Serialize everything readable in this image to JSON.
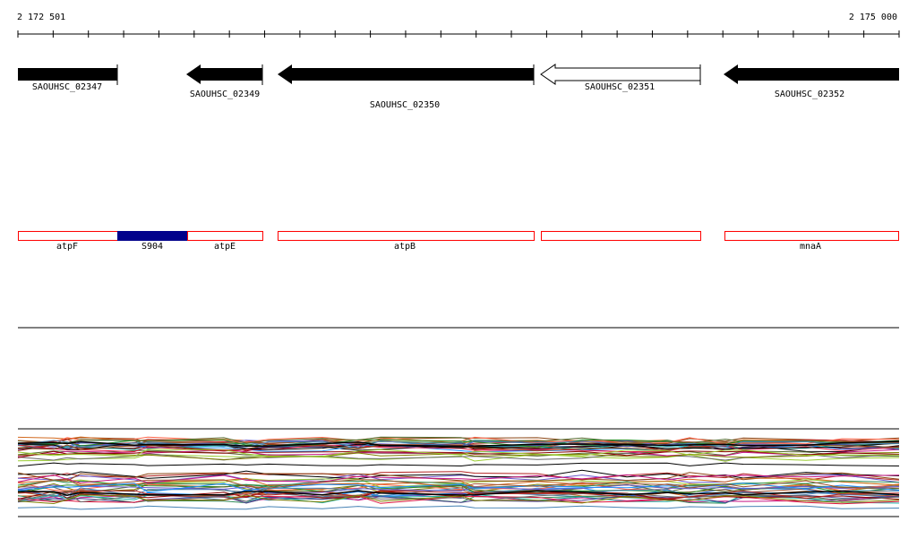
{
  "coordinates": {
    "start": "2 172 501",
    "end": "2 175 000"
  },
  "genes": [
    {
      "name": "SAOUHSC_02347",
      "strand": "+",
      "filled": true
    },
    {
      "name": "SAOUHSC_02349",
      "strand": "-",
      "filled": true
    },
    {
      "name": "SAOUHSC_02350",
      "strand": "-",
      "filled": true
    },
    {
      "name": "SAOUHSC_02351",
      "strand": "-",
      "filled": false
    },
    {
      "name": "SAOUHSC_02352",
      "strand": "-",
      "filled": true
    }
  ],
  "features": [
    {
      "name": "atpF",
      "color": "#ff0000"
    },
    {
      "name": "S904",
      "color": "#00008b"
    },
    {
      "name": "atpE",
      "color": "#ff0000"
    },
    {
      "name": "atpB",
      "color": "#ff0000"
    },
    {
      "name": "",
      "color": "#ff0000"
    },
    {
      "name": "mnaA",
      "color": "#ff0000"
    }
  ]
}
